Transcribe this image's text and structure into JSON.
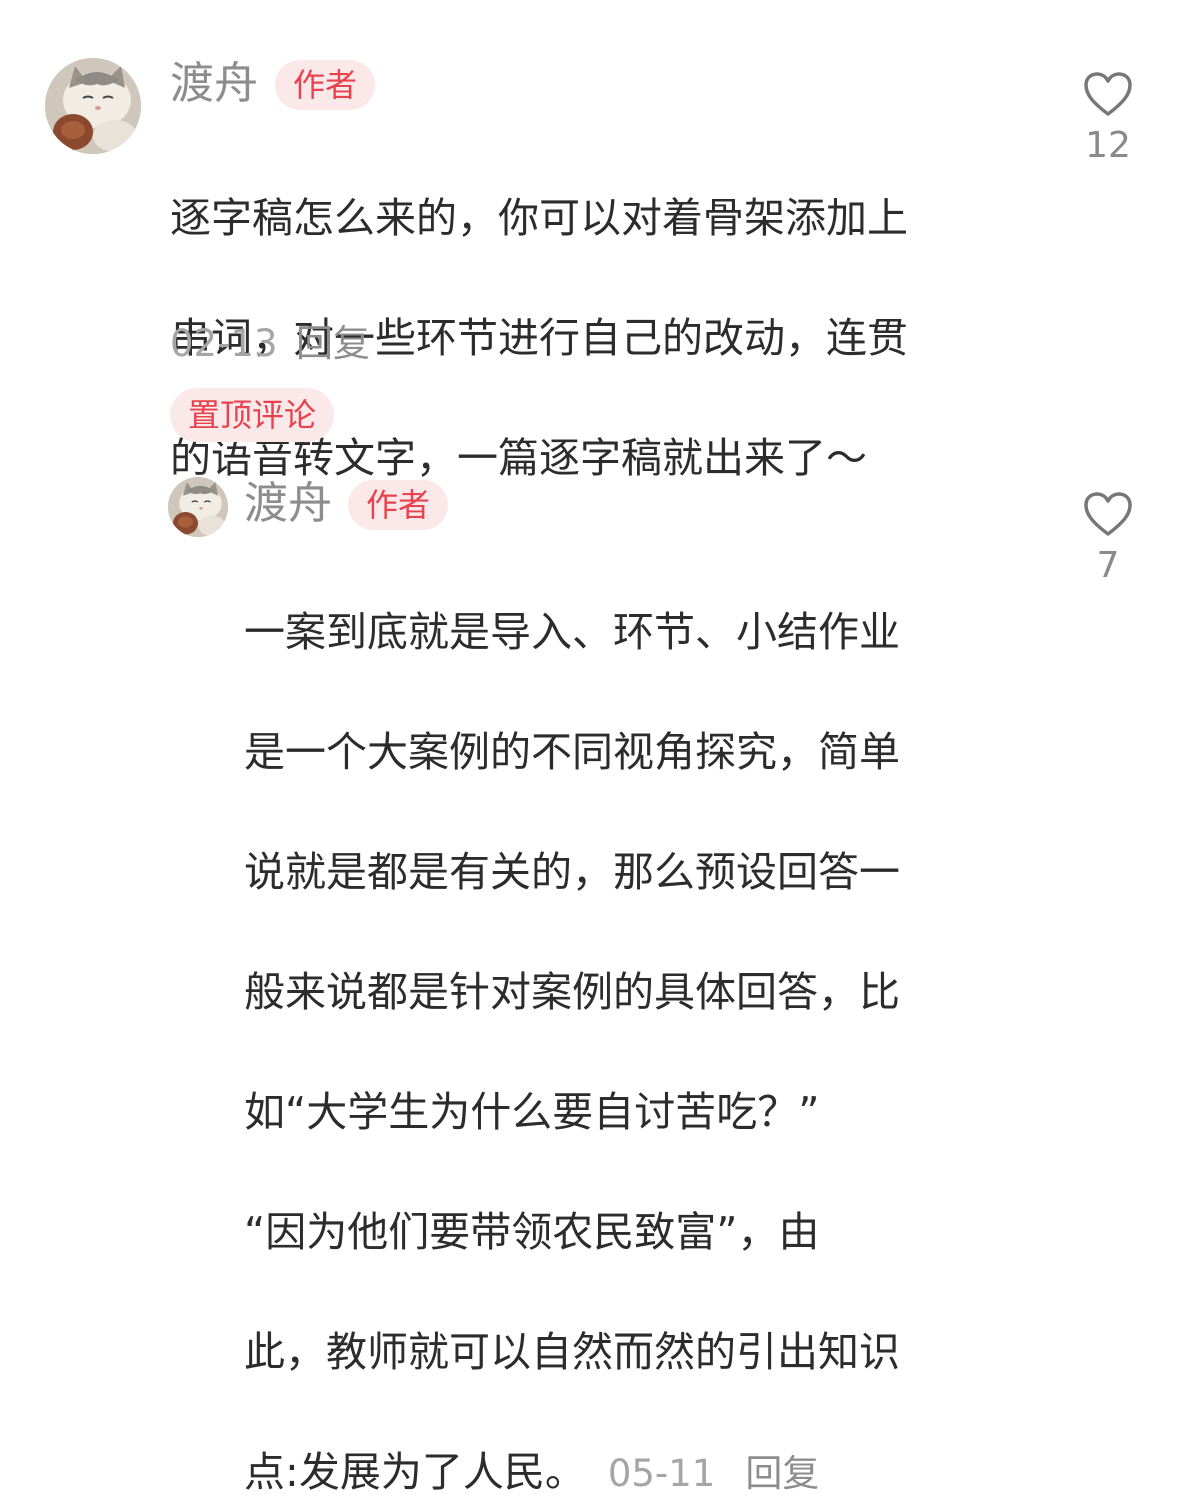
{
  "comment": {
    "username": "渡舟",
    "badge": "作者",
    "lines": [
      "逐字稿怎么来的，你可以对着骨架添加上",
      "串词，对一些环节进行自己的改动，连贯",
      "的语音转文字，一篇逐字稿就出来了～"
    ],
    "date": "02-13",
    "reply_label": "回复",
    "like_icon": "heart-outline-icon",
    "likes": "12"
  },
  "pinned_label": "置顶评论",
  "reply_comment": {
    "username": "渡舟",
    "badge": "作者",
    "lines": [
      "一案到底就是导入、环节、小结作业",
      "是一个大案例的不同视角探究，简单",
      "说就是都是有关的，那么预设回答一",
      "般来说都是针对案例的具体回答，比",
      "如“大学生为什么要自讨苦吃？”",
      "“因为他们要带领农民致富”，由",
      "此，教师就可以自然而然的引出知识",
      "点:发展为了人民。"
    ],
    "date": "05-11",
    "reply_label": "回复",
    "like_icon": "heart-outline-icon",
    "likes": "7"
  },
  "colors": {
    "badge_text": "#e8424f",
    "badge_bg": "#fbe9ea",
    "username": "#8d8d8d",
    "meta": "#a5a5a5",
    "body_text": "#2c2c2c"
  }
}
